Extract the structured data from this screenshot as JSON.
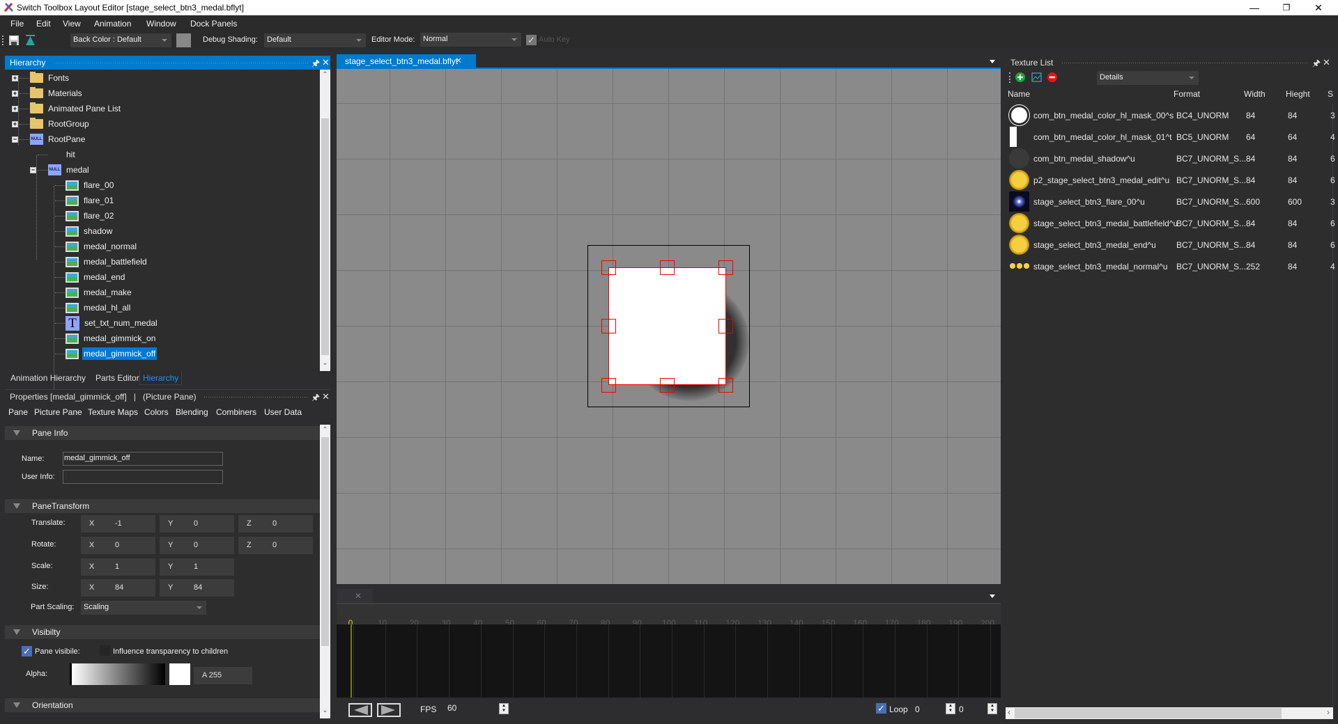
{
  "window": {
    "title": "Switch Toolbox Layout Editor [stage_select_btn3_medal.bflyt]",
    "controls": {
      "minimize": "—",
      "maximize": "❐",
      "close": "✕"
    }
  },
  "menu": [
    "File",
    "Edit",
    "View",
    "Animation",
    "Window",
    "Dock Panels"
  ],
  "toolbar": {
    "back_color": "Back Color : Default",
    "back_color_swatch": "#888888",
    "debug_shading_label": "Debug Shading:",
    "debug_shading_value": "Default",
    "editor_mode_label": "Editor Mode:",
    "editor_mode_value": "Normal",
    "auto_key_label": "Auto Key",
    "auto_key_checked": true
  },
  "hierarchy": {
    "title": "Hierarchy",
    "items": [
      {
        "label": "Fonts",
        "icon": "folder-icon",
        "level": 0,
        "expander": "+"
      },
      {
        "label": "Materials",
        "icon": "folder-icon",
        "level": 0,
        "expander": "+"
      },
      {
        "label": "Animated Pane List",
        "icon": "folder-icon",
        "level": 0,
        "expander": "+"
      },
      {
        "label": "RootGroup",
        "icon": "folder-icon",
        "level": 0,
        "expander": "+"
      },
      {
        "label": "RootPane",
        "icon": "null-pane-icon",
        "level": 0,
        "expander": "−"
      },
      {
        "label": "hit",
        "icon": "",
        "level": 1,
        "expander": ""
      },
      {
        "label": "medal",
        "icon": "null-pane-icon",
        "level": 1,
        "expander": "−"
      },
      {
        "label": "flare_00",
        "icon": "picture-pane-icon",
        "level": 2
      },
      {
        "label": "flare_01",
        "icon": "picture-pane-icon",
        "level": 2
      },
      {
        "label": "flare_02",
        "icon": "picture-pane-icon",
        "level": 2
      },
      {
        "label": "shadow",
        "icon": "picture-pane-icon",
        "level": 2
      },
      {
        "label": "medal_normal",
        "icon": "picture-pane-icon",
        "level": 2
      },
      {
        "label": "medal_battlefield",
        "icon": "picture-pane-icon",
        "level": 2
      },
      {
        "label": "medal_end",
        "icon": "picture-pane-icon",
        "level": 2
      },
      {
        "label": "medal_make",
        "icon": "picture-pane-icon",
        "level": 2
      },
      {
        "label": "medal_hl_all",
        "icon": "picture-pane-icon",
        "level": 2
      },
      {
        "label": "set_txt_num_medal",
        "icon": "text-pane-icon",
        "level": 2
      },
      {
        "label": "medal_gimmick_on",
        "icon": "picture-pane-icon",
        "level": 2
      },
      {
        "label": "medal_gimmick_off",
        "icon": "picture-pane-icon",
        "level": 2,
        "selected": true
      }
    ],
    "null_icon_text": "NULL",
    "text_icon_text": "T"
  },
  "bottom_tabs": [
    "Animation Hierarchy",
    "Parts Editor",
    "Hierarchy"
  ],
  "properties": {
    "title": "Properties [medal_gimmick_off]   |   (Picture Pane)",
    "tabs": [
      "Pane",
      "Picture Pane",
      "Texture Maps",
      "Colors",
      "Blending",
      "Combiners",
      "User Data"
    ],
    "pane_info": {
      "header": "Pane Info",
      "name_label": "Name:",
      "name_value": "medal_gimmick_off",
      "user_info_label": "User Info:",
      "user_info_value": ""
    },
    "transform": {
      "header": "PaneTransform",
      "translate": {
        "label": "Translate:",
        "x": "-1",
        "y": "0",
        "z": "0"
      },
      "rotate": {
        "label": "Rotate:",
        "x": "0",
        "y": "0",
        "z": "0"
      },
      "scale": {
        "label": "Scale:",
        "x": "1",
        "y": "1"
      },
      "size": {
        "label": "Size:",
        "x": "84",
        "y": "84"
      },
      "part_scaling_label": "Part Scaling:",
      "part_scaling_value": "Scaling",
      "axis": {
        "x": "X",
        "y": "Y",
        "z": "Z"
      }
    },
    "visibility": {
      "header": "Visibilty",
      "pane_visible_label": "Pane visibile:",
      "pane_visible": true,
      "influence_label": "Influence transparency to children",
      "influence": false,
      "alpha_label": "Alpha:",
      "alpha_value": "A  255",
      "alpha": 255
    },
    "orientation": {
      "header": "Orientation"
    }
  },
  "document": {
    "tab_label": "stage_select_btn3_medal.bflyt",
    "close": "✕"
  },
  "timeline": {
    "tab_close": "✕",
    "ticks": [
      "0",
      "10",
      "20",
      "30",
      "40",
      "50",
      "60",
      "70",
      "80",
      "90",
      "100",
      "110",
      "120",
      "130",
      "140",
      "150",
      "160",
      "170",
      "180",
      "190",
      "200"
    ],
    "current_frame": 0,
    "fps_label": "FPS",
    "fps_value": "60",
    "loop_label": "Loop",
    "loop_checked": true,
    "start_frame": "0",
    "end_frame": "0"
  },
  "texture_list": {
    "title": "Texture List",
    "view_mode": "Details",
    "columns": [
      "Name",
      "Format",
      "Width",
      "Hieght",
      "S"
    ],
    "rows": [
      {
        "name": "com_btn_medal_color_hl_mask_00^s",
        "format": "BC4_UNORM",
        "width": "84",
        "height": "84",
        "s": "3",
        "thumb": "white-circle"
      },
      {
        "name": "com_btn_medal_color_hl_mask_01^t",
        "format": "BC5_UNORM",
        "width": "64",
        "height": "64",
        "s": "4",
        "thumb": "white-bar"
      },
      {
        "name": "com_btn_medal_shadow^u",
        "format": "BC7_UNORM_S...",
        "width": "84",
        "height": "84",
        "s": "6",
        "thumb": "dark-circle"
      },
      {
        "name": "p2_stage_select_btn3_medal_edit^u",
        "format": "BC7_UNORM_S...",
        "width": "84",
        "height": "84",
        "s": "6",
        "thumb": "gold-medal"
      },
      {
        "name": "stage_select_btn3_flare_00^u",
        "format": "BC7_UNORM_S...",
        "width": "600",
        "height": "600",
        "s": "3",
        "thumb": "flare"
      },
      {
        "name": "stage_select_btn3_medal_battlefield^u",
        "format": "BC7_UNORM_S...",
        "width": "84",
        "height": "84",
        "s": "6",
        "thumb": "gold-medal"
      },
      {
        "name": "stage_select_btn3_medal_end^u",
        "format": "BC7_UNORM_S...",
        "width": "84",
        "height": "84",
        "s": "6",
        "thumb": "gold-medal"
      },
      {
        "name": "stage_select_btn3_medal_normal^u",
        "format": "BC7_UNORM_S...",
        "width": "252",
        "height": "84",
        "s": "4",
        "thumb": "three-medals"
      }
    ]
  },
  "colors": {
    "accent": "#007acc",
    "selection_red": "#e00000",
    "canvas_bg": "#8a8a8a",
    "timeline_current": "#d6d600"
  },
  "icons": {
    "pin": "📌",
    "close": "✕",
    "check": "✓"
  }
}
